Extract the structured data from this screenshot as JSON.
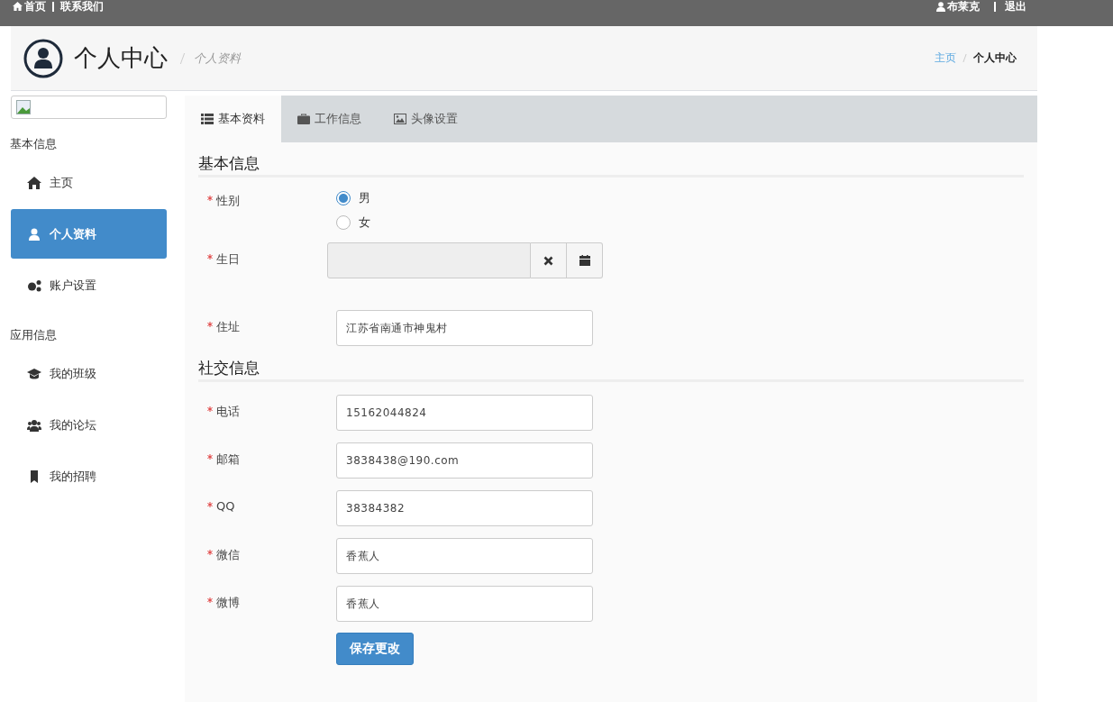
{
  "topbar": {
    "links": [
      {
        "label": "首页"
      },
      {
        "label": "联系我们"
      }
    ],
    "user": "布莱克",
    "logout": "退出"
  },
  "header": {
    "title": "个人中心",
    "subtitle": "个人资料",
    "breadcrumb": [
      {
        "label": "主页",
        "kind": "link"
      },
      {
        "label": "个人中心",
        "kind": "current"
      }
    ]
  },
  "sidebar": {
    "sections": [
      {
        "heading": "基本信息",
        "items": [
          {
            "label": "主页",
            "selected": false
          },
          {
            "label": "个人资料",
            "selected": true
          },
          {
            "label": "账户设置",
            "selected": false
          }
        ]
      },
      {
        "heading": "应用信息",
        "items": [
          {
            "label": "我的班级",
            "selected": false
          },
          {
            "label": "我的论坛",
            "selected": false
          },
          {
            "label": "我的招聘",
            "selected": false
          }
        ]
      }
    ]
  },
  "tabs": [
    {
      "label": "基本资料",
      "selected": true
    },
    {
      "label": "工作信息",
      "selected": false
    },
    {
      "label": "头像设置",
      "selected": false
    }
  ],
  "sections": [
    {
      "heading": "基本信息",
      "fields": [
        {
          "label": "性别",
          "required": true,
          "kind": "radio",
          "options": [
            {
              "label": "男",
              "selected": true
            },
            {
              "label": "女",
              "selected": false
            }
          ]
        },
        {
          "label": "生日",
          "required": true,
          "kind": "date",
          "disabled": true
        },
        {
          "label": "住址",
          "required": true,
          "kind": "text",
          "value": "江苏省南通市神鬼村"
        }
      ]
    },
    {
      "heading": "社交信息",
      "fields": [
        {
          "label": "电话",
          "required": true,
          "kind": "text",
          "value": "15162044824"
        },
        {
          "label": "邮箱",
          "required": true,
          "kind": "text",
          "value": "3838438@190.com"
        },
        {
          "label": "QQ",
          "required": true,
          "kind": "text",
          "value": "38384382"
        },
        {
          "label": "微信",
          "required": true,
          "kind": "text",
          "value": "香蕉人"
        },
        {
          "label": "微博",
          "required": true,
          "kind": "text",
          "value": "香蕉人"
        }
      ]
    }
  ],
  "save_button": "保存更改"
}
